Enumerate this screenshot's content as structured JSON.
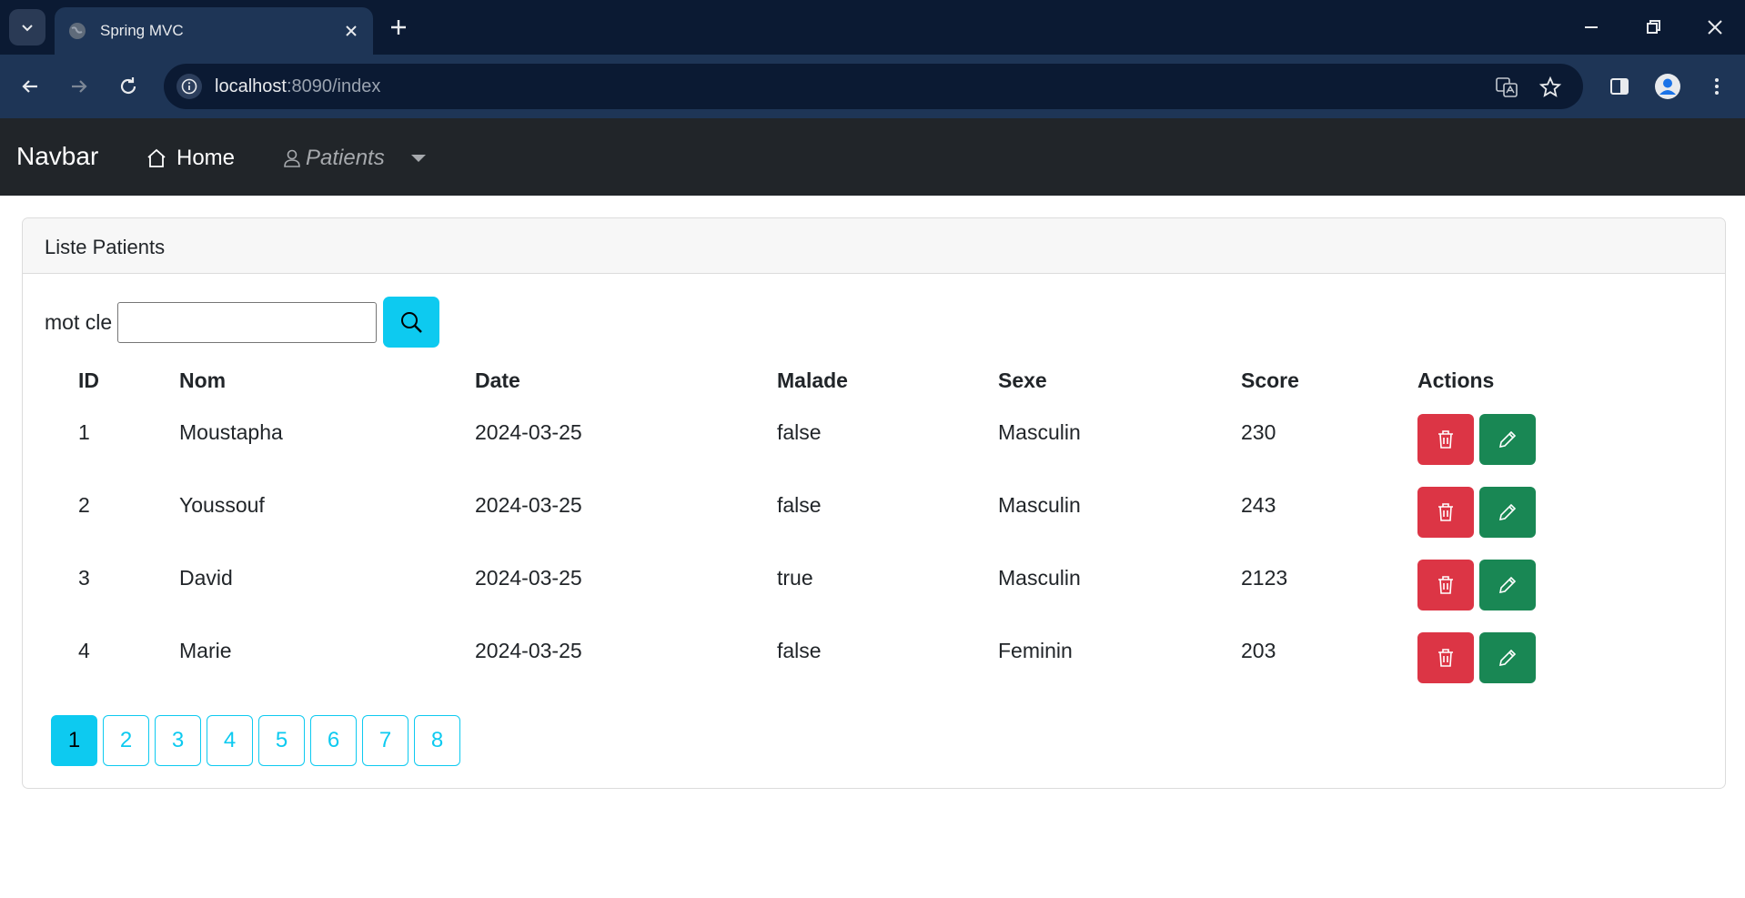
{
  "browser": {
    "tab_title": "Spring MVC",
    "url_host": "localhost",
    "url_rest": ":8090/index"
  },
  "navbar": {
    "brand": "Navbar",
    "home_label": "Home",
    "patients_label": "Patients"
  },
  "card": {
    "header": "Liste Patients",
    "search_label": "mot cle",
    "search_value": ""
  },
  "table": {
    "columns": [
      "ID",
      "Nom",
      "Date",
      "Malade",
      "Sexe",
      "Score",
      "Actions"
    ],
    "rows": [
      {
        "id": "1",
        "nom": "Moustapha",
        "date": "2024-03-25",
        "malade": "false",
        "sexe": "Masculin",
        "score": "230"
      },
      {
        "id": "2",
        "nom": "Youssouf",
        "date": "2024-03-25",
        "malade": "false",
        "sexe": "Masculin",
        "score": "243"
      },
      {
        "id": "3",
        "nom": "David",
        "date": "2024-03-25",
        "malade": "true",
        "sexe": "Masculin",
        "score": "2123"
      },
      {
        "id": "4",
        "nom": "Marie",
        "date": "2024-03-25",
        "malade": "false",
        "sexe": "Feminin",
        "score": "203"
      }
    ]
  },
  "pagination": {
    "pages": [
      "1",
      "2",
      "3",
      "4",
      "5",
      "6",
      "7",
      "8"
    ],
    "active_page": "1"
  },
  "colors": {
    "navbar_bg": "#212529",
    "info": "#0dcaf0",
    "danger": "#dc3545",
    "success": "#198754"
  }
}
